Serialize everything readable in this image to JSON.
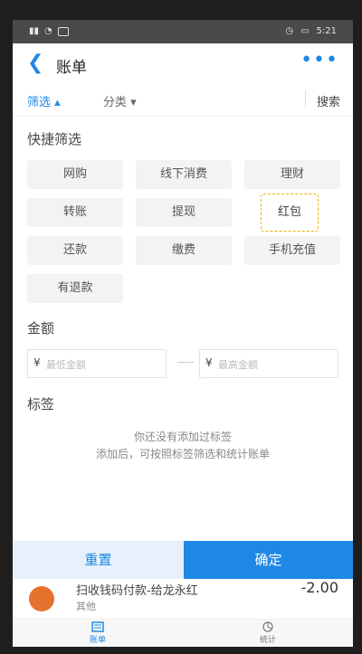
{
  "statusbar": {
    "time": "5:21"
  },
  "header": {
    "title": "账单",
    "back_icon": "back-arrow-icon",
    "more_icon": "more-dots-icon"
  },
  "filterbar": {
    "tab1": "筛选",
    "tab2": "分类",
    "search": "搜索"
  },
  "quick_filter": {
    "title": "快捷筛选",
    "items": [
      "网购",
      "线下消费",
      "理财",
      "转账",
      "提现",
      "红包",
      "还款",
      "缴费",
      "手机充值",
      "有退款"
    ],
    "selected": "红包"
  },
  "amount": {
    "title": "金额",
    "currency": "¥",
    "min_placeholder": "最低金额",
    "max_placeholder": "最高金额"
  },
  "tags": {
    "title": "标签",
    "empty_line1": "你还没有添加过标签",
    "empty_line2": "添加后，可按照标签筛选和统计账单"
  },
  "buttons": {
    "reset": "重置",
    "confirm": "确定"
  },
  "list_item": {
    "title": "扫收钱码付款-给龙永红",
    "subtitle": "其他",
    "amount": "-2.00"
  },
  "tabs": [
    {
      "label": "账单"
    },
    {
      "label": "统计"
    }
  ],
  "colors": {
    "accent": "#1e88e5",
    "selected_border": "#f0b400"
  }
}
